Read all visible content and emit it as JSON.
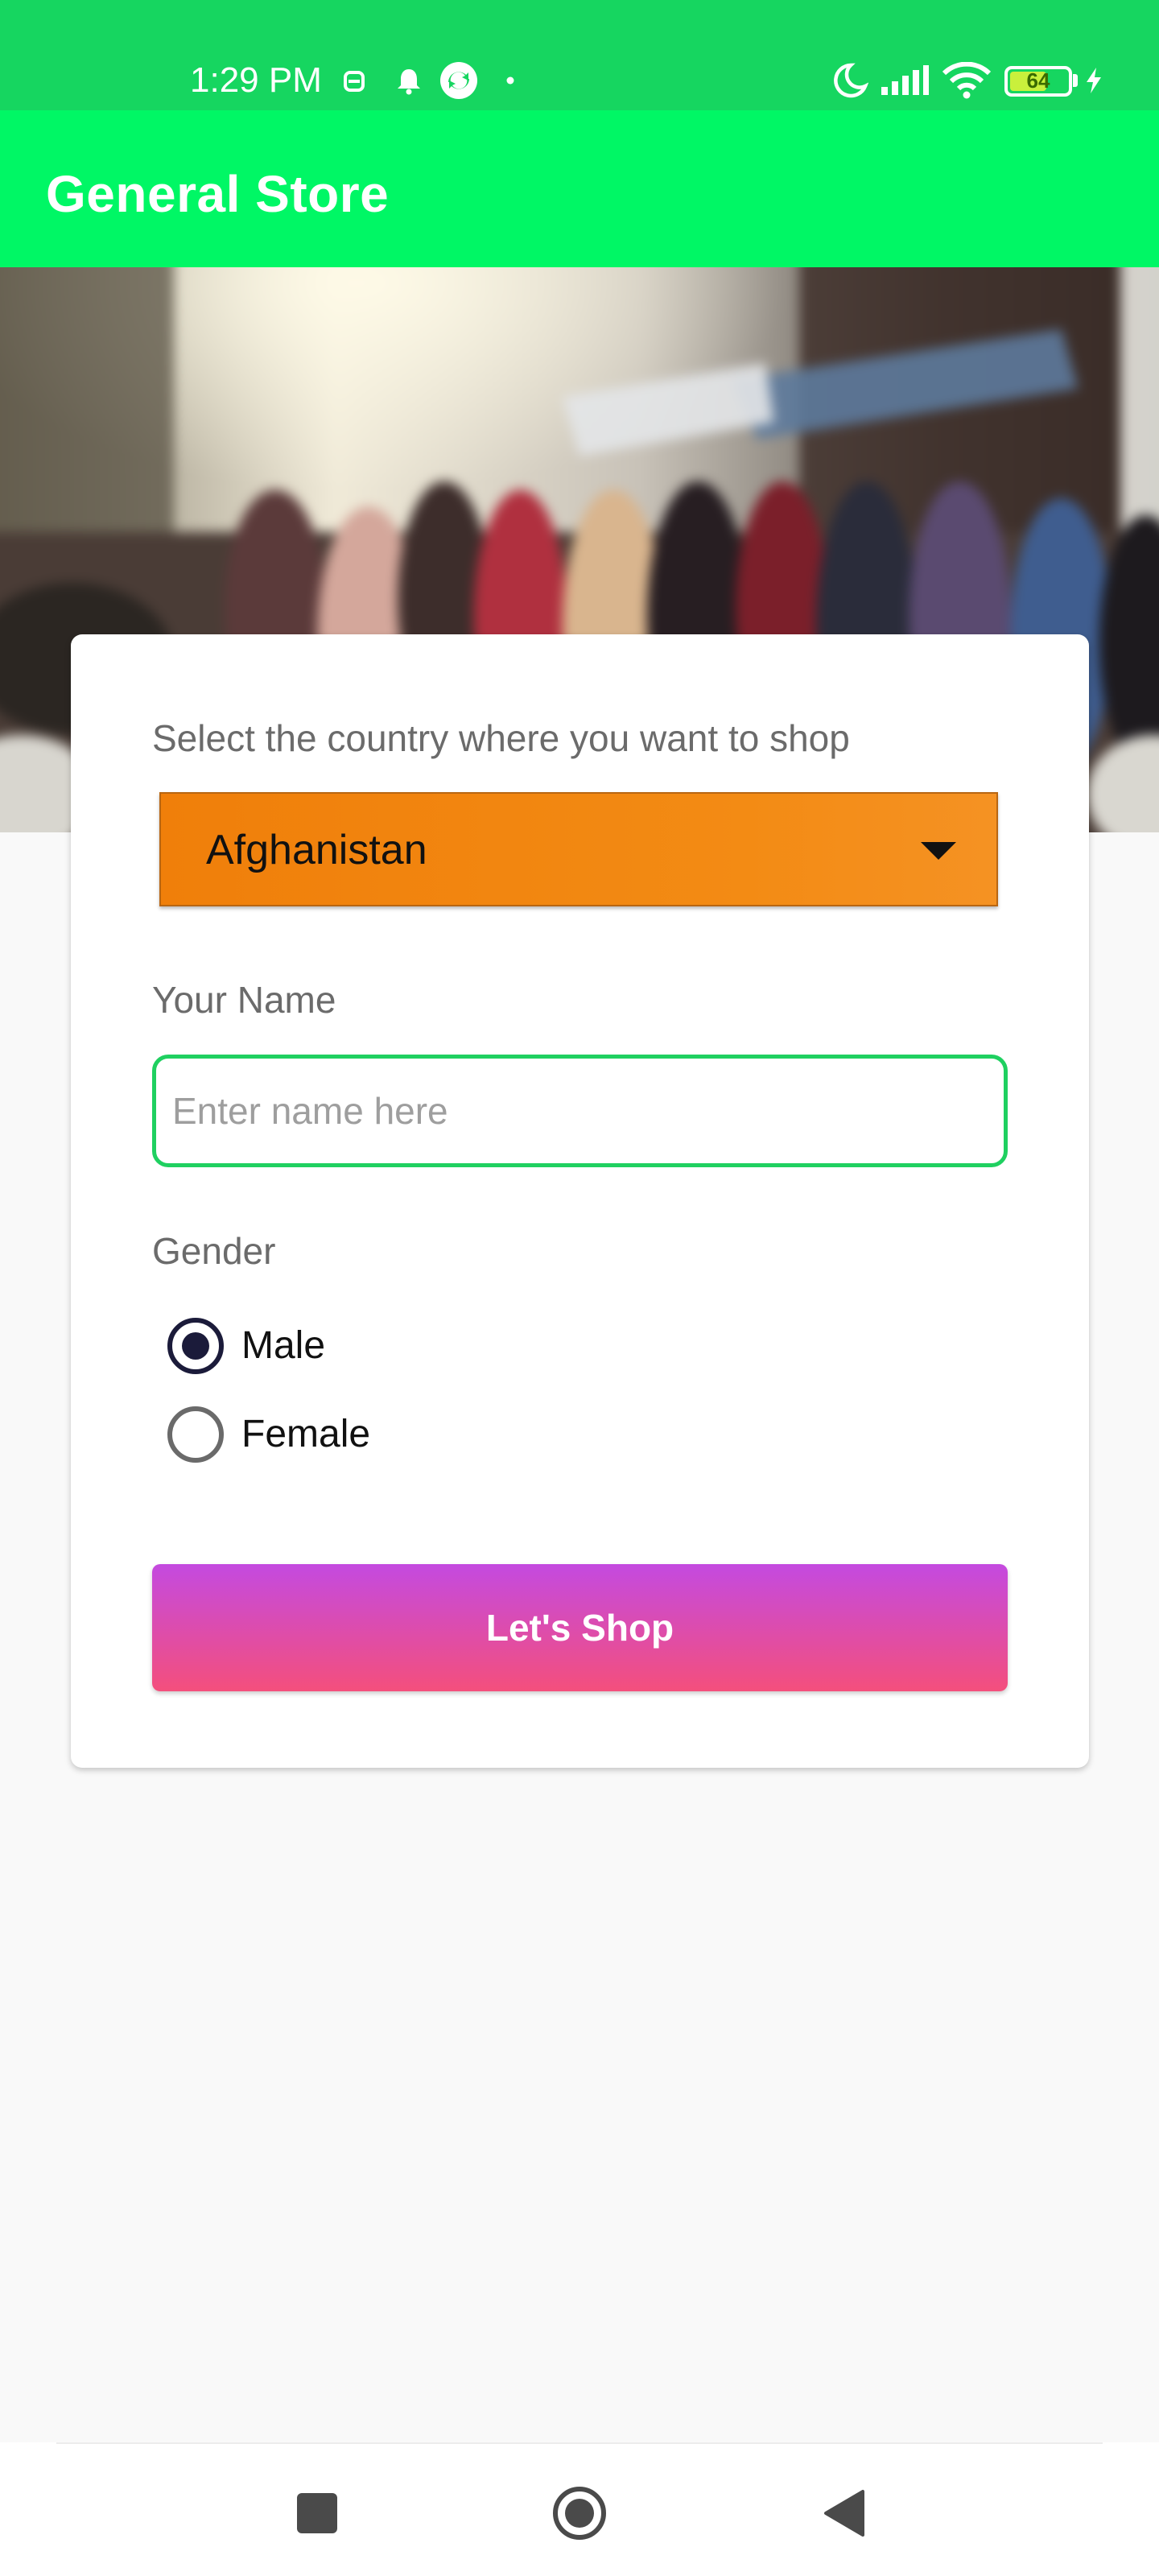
{
  "status_bar": {
    "time": "1:29 PM",
    "battery": "64",
    "battery_level": 0.64,
    "icons": [
      "dnd-icon",
      "notification-bell-icon",
      "sync-icon",
      "dot-icon",
      "moon-icon",
      "signal-icon",
      "wifi-icon",
      "battery-icon",
      "charging-icon"
    ]
  },
  "app_bar": {
    "title": "General Store",
    "color": "#00f765"
  },
  "form": {
    "country_label": "Select the country where you want to shop",
    "country_selected": "Afghanistan",
    "name_label": "Your Name",
    "name_placeholder": "Enter name here",
    "name_value": "",
    "gender_label": "Gender",
    "gender_options": [
      {
        "label": "Male",
        "checked": true
      },
      {
        "label": "Female",
        "checked": false
      }
    ],
    "shop_button": "Let's  Shop"
  },
  "colors": {
    "status_bar": "#16d660",
    "spinner": "#f38b14",
    "input_border": "#1fd060",
    "button_top": "#c44ae0",
    "button_bottom": "#f44f7c"
  },
  "nav_bar": {
    "icons": [
      "recents-square-icon",
      "home-circle-icon",
      "back-triangle-icon"
    ]
  }
}
